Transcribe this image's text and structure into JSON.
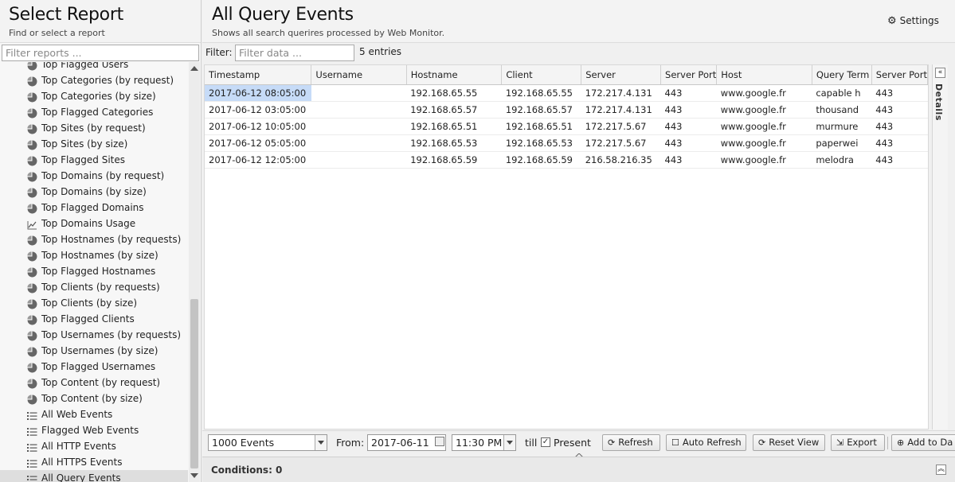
{
  "left": {
    "title": "Select Report",
    "subtitle": "Find or select a report",
    "filter_placeholder": "Filter reports ...",
    "items": [
      {
        "label": "Top Flagged Users",
        "icon": "pie-chart-icon"
      },
      {
        "label": "Top Categories (by request)",
        "icon": "pie-chart-icon"
      },
      {
        "label": "Top Categories (by size)",
        "icon": "pie-chart-icon"
      },
      {
        "label": "Top Flagged Categories",
        "icon": "pie-chart-icon"
      },
      {
        "label": "Top Sites (by request)",
        "icon": "pie-chart-icon"
      },
      {
        "label": "Top Sites (by size)",
        "icon": "pie-chart-icon"
      },
      {
        "label": "Top Flagged Sites",
        "icon": "pie-chart-icon"
      },
      {
        "label": "Top Domains (by request)",
        "icon": "pie-chart-icon"
      },
      {
        "label": "Top Domains (by size)",
        "icon": "pie-chart-icon"
      },
      {
        "label": "Top Flagged Domains",
        "icon": "pie-chart-icon"
      },
      {
        "label": "Top Domains Usage",
        "icon": "line-chart-icon"
      },
      {
        "label": "Top Hostnames (by requests)",
        "icon": "pie-chart-icon"
      },
      {
        "label": "Top Hostnames (by size)",
        "icon": "pie-chart-icon"
      },
      {
        "label": "Top Flagged Hostnames",
        "icon": "pie-chart-icon"
      },
      {
        "label": "Top Clients (by requests)",
        "icon": "pie-chart-icon"
      },
      {
        "label": "Top Clients (by size)",
        "icon": "pie-chart-icon"
      },
      {
        "label": "Top Flagged Clients",
        "icon": "pie-chart-icon"
      },
      {
        "label": "Top Usernames (by requests)",
        "icon": "pie-chart-icon"
      },
      {
        "label": "Top Usernames (by size)",
        "icon": "pie-chart-icon"
      },
      {
        "label": "Top Flagged Usernames",
        "icon": "pie-chart-icon"
      },
      {
        "label": "Top Content (by request)",
        "icon": "pie-chart-icon"
      },
      {
        "label": "Top Content (by size)",
        "icon": "pie-chart-icon"
      },
      {
        "label": "All Web Events",
        "icon": "list-icon"
      },
      {
        "label": "Flagged Web Events",
        "icon": "list-icon"
      },
      {
        "label": "All HTTP Events",
        "icon": "list-icon"
      },
      {
        "label": "All HTTPS Events",
        "icon": "list-icon"
      },
      {
        "label": "All Query Events",
        "icon": "list-icon",
        "selected": true
      }
    ]
  },
  "main": {
    "title": "All Query Events",
    "subtitle": "Shows all search querires processed by Web Monitor.",
    "settings_label": "Settings",
    "filter_label": "Filter:",
    "filter_placeholder": "Filter data ...",
    "entries": "5 entries",
    "details_label": "Details",
    "columns": [
      "Timestamp",
      "Username",
      "Hostname",
      "Client",
      "Server",
      "Server Port",
      "Host",
      "Query Term",
      "Server Port"
    ],
    "rows": [
      [
        "2017-06-12 08:05:00",
        "",
        "192.168.65.55",
        "192.168.65.55",
        "172.217.4.131",
        "443",
        "www.google.fr",
        "capable h",
        "443"
      ],
      [
        "2017-06-12 03:05:00",
        "",
        "192.168.65.57",
        "192.168.65.57",
        "172.217.4.131",
        "443",
        "www.google.fr",
        "thousand",
        "443"
      ],
      [
        "2017-06-12 10:05:00",
        "",
        "192.168.65.51",
        "192.168.65.51",
        "172.217.5.67",
        "443",
        "www.google.fr",
        "murmure",
        "443"
      ],
      [
        "2017-06-12 05:05:00",
        "",
        "192.168.65.53",
        "192.168.65.53",
        "172.217.5.67",
        "443",
        "www.google.fr",
        "paperwei",
        "443"
      ],
      [
        "2017-06-12 12:05:00",
        "",
        "192.168.65.59",
        "192.168.65.59",
        "216.58.216.35",
        "443",
        "www.google.fr",
        "melodra",
        "443"
      ]
    ]
  },
  "toolbar": {
    "events_value": "1000 Events",
    "from_label": "From:",
    "from_date": "2017-06-11",
    "from_time": "11:30 PM",
    "till_label": "till",
    "present_checked": true,
    "present_label": "Present",
    "refresh_label": "Refresh",
    "auto_refresh_label": "Auto Refresh",
    "reset_view_label": "Reset View",
    "export_label": "Export",
    "add_to_label": "Add to Da"
  },
  "conditions": {
    "label": "Conditions: 0"
  }
}
